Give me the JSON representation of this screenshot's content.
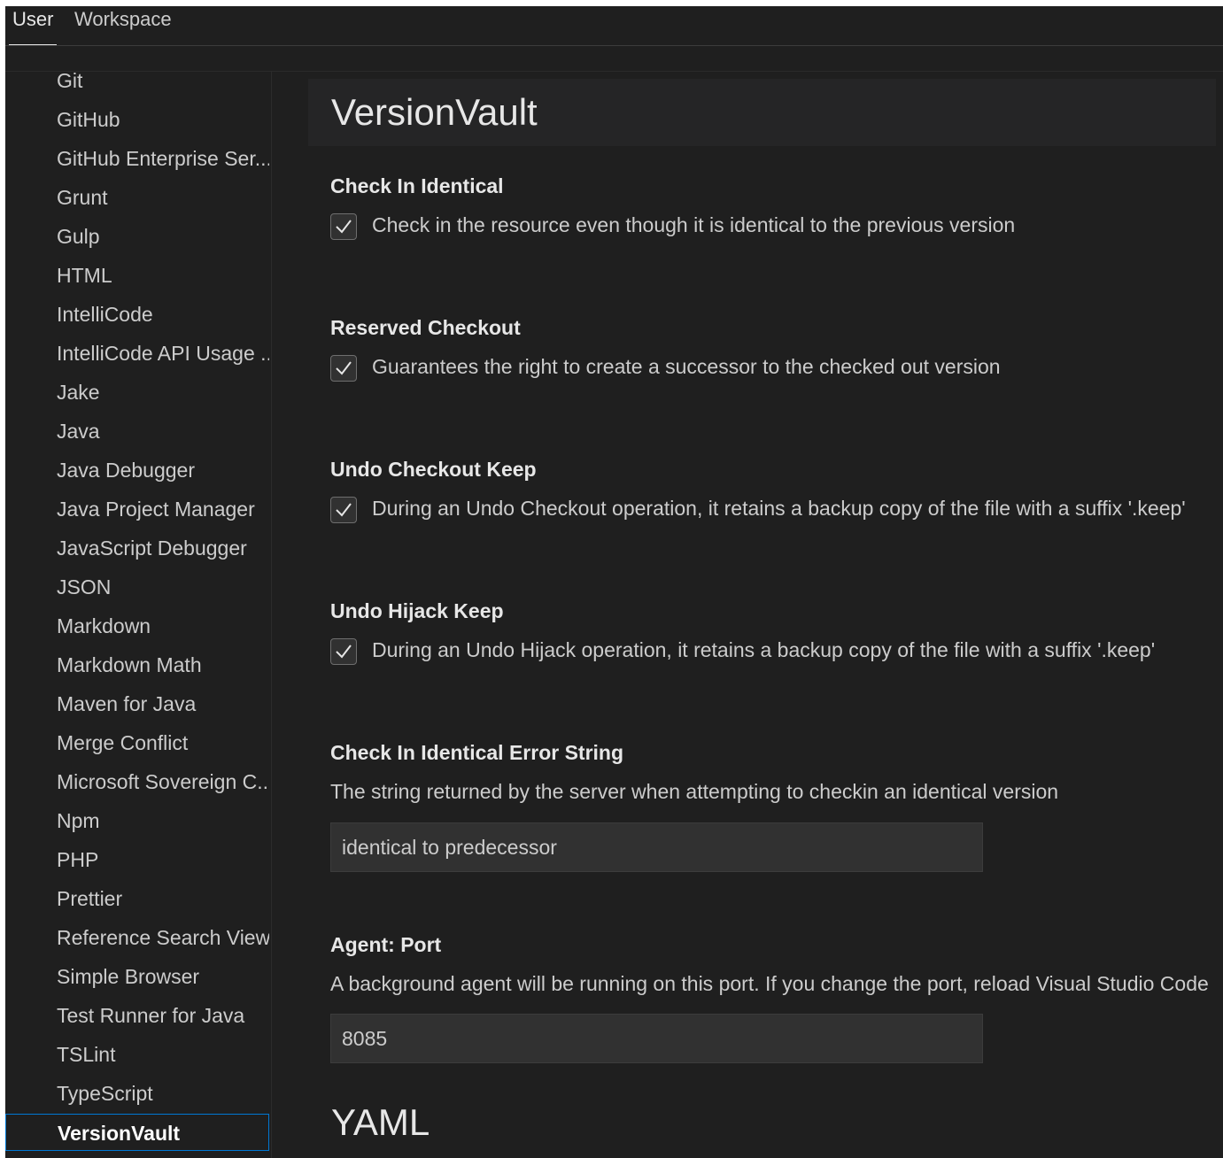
{
  "tabs": {
    "user": "User",
    "workspace": "Workspace"
  },
  "sidebar": {
    "items": [
      "Git",
      "GitHub",
      "GitHub Enterprise Ser...",
      "Grunt",
      "Gulp",
      "HTML",
      "IntelliCode",
      "IntelliCode API Usage ...",
      "Jake",
      "Java",
      "Java Debugger",
      "Java Project Manager",
      "JavaScript Debugger",
      "JSON",
      "Markdown",
      "Markdown Math",
      "Maven for Java",
      "Merge Conflict",
      "Microsoft Sovereign C...",
      "Npm",
      "PHP",
      "Prettier",
      "Reference Search View",
      "Simple Browser",
      "Test Runner for Java",
      "TSLint",
      "TypeScript",
      "VersionVault"
    ],
    "selected": "VersionVault"
  },
  "section": {
    "title": "VersionVault"
  },
  "settings": {
    "check_in_identical": {
      "title": "Check In Identical",
      "description": "Check in the resource even though it is identical to the previous version",
      "checked": true
    },
    "reserved_checkout": {
      "title": "Reserved Checkout",
      "description": "Guarantees the right to create a successor to the checked out version",
      "checked": true
    },
    "undo_checkout_keep": {
      "title": "Undo Checkout Keep",
      "description": "During an Undo Checkout operation, it retains a backup copy of the file with a suffix '.keep'",
      "checked": true
    },
    "undo_hijack_keep": {
      "title": "Undo Hijack Keep",
      "description": "During an Undo Hijack operation, it retains a backup copy of the file with a suffix '.keep'",
      "checked": true
    },
    "check_in_identical_error_string": {
      "title": "Check In Identical Error String",
      "description": "The string returned by the server when attempting to checkin an identical version",
      "value": "identical to predecessor"
    },
    "agent_port": {
      "title": "Agent: Port",
      "description": "A background agent will be running on this port. If you change the port, reload Visual Studio Code",
      "value": "8085"
    }
  },
  "next_section": {
    "title": "YAML"
  },
  "colors": {
    "accent": "#0078d4",
    "background": "#1f1f1f",
    "input_bg": "#313131"
  },
  "icons": {
    "checkmark": "check-icon"
  }
}
